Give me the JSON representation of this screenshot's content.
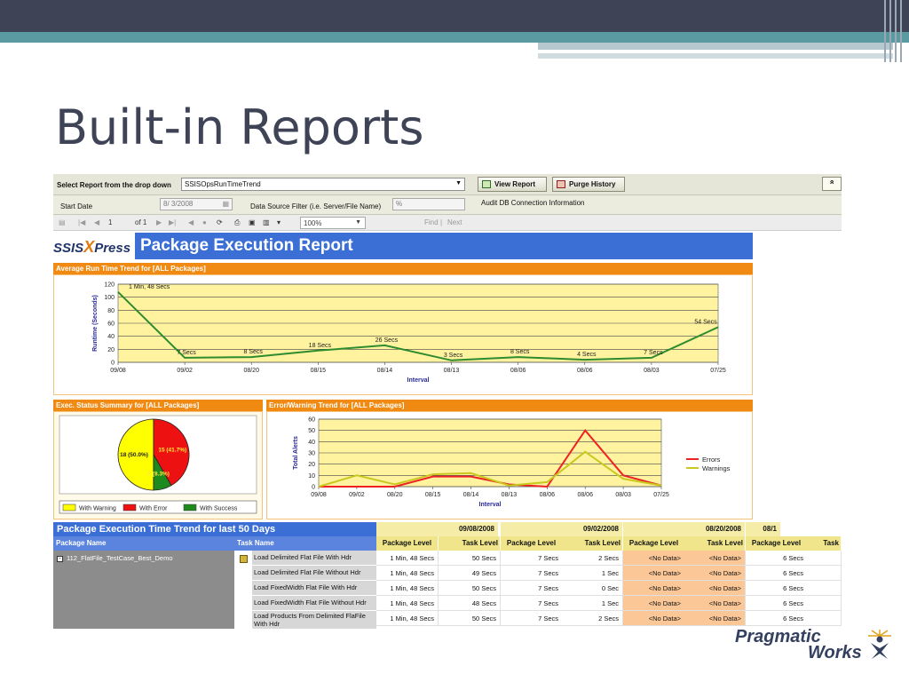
{
  "slide": {
    "title": "Built-in Reports"
  },
  "report_viewer": {
    "select_label": "Select Report from the drop down",
    "selected_report": "SSISOpsRunTimeTrend",
    "view_report_label": "View Report",
    "purge_history_label": "Purge History",
    "collapse_glyph": "»",
    "start_date_label": "Start Date",
    "start_date_value": "8/ 3/2008",
    "data_source_filter_label": "Data Source Filter (i.e. Server/File Name)",
    "data_source_filter_value": "%",
    "audit_db_label": "Audit DB Connection Information"
  },
  "toolbar": {
    "page_current": "1",
    "page_of": "of 1",
    "zoom": "100%",
    "find_label": "Find",
    "next_label": "Next"
  },
  "report_header": {
    "logo_text_1": "SSIS",
    "logo_x": "X",
    "logo_text_2": "Press",
    "title": "Package Execution Report"
  },
  "sections": {
    "avg_runtime": "Average Run Time Trend for [ALL Packages]",
    "exec_status": "Exec. Status Summary for [ALL Packages]",
    "error_warning": "Error/Warning Trend for [ALL Packages]"
  },
  "chart_data": [
    {
      "type": "line",
      "title": "Average Run Time Trend for [ALL Packages]",
      "xlabel": "Interval",
      "ylabel": "Runtime (Seconds)",
      "ylim": [
        0,
        120
      ],
      "yticks": [
        0,
        20,
        40,
        60,
        80,
        100,
        120
      ],
      "categories": [
        "09/08",
        "09/02",
        "08/20",
        "08/15",
        "08/14",
        "08/13",
        "08/06",
        "08/06",
        "08/03",
        "07/25"
      ],
      "series": [
        {
          "values": [
            108,
            7,
            8,
            18,
            26,
            3,
            8,
            4,
            7,
            54
          ],
          "labels": [
            "1 Min, 48 Secs",
            "7 Secs",
            "8 Secs",
            "18 Secs",
            "26 Secs",
            "3 Secs",
            "8 Secs",
            "4 Secs",
            "7 Secs",
            "54 Secs"
          ],
          "color": "#2e8b2e"
        }
      ],
      "grid": true,
      "plot_background": "#fff3a0"
    },
    {
      "type": "pie",
      "title": "Exec. Status Summary for [ALL Packages]",
      "slices": [
        {
          "name": "With Warning",
          "value": 50.0,
          "label": "18 (50.0%)",
          "color": "#ffff00"
        },
        {
          "name": "With Error",
          "value": 41.7,
          "label": "15 (41.7%)",
          "color": "#ee1111"
        },
        {
          "name": "With Success",
          "value": 8.3,
          "label": "3 (8.3%)",
          "color": "#1e8a1e"
        }
      ],
      "legend_position": "bottom"
    },
    {
      "type": "line",
      "title": "Error/Warning Trend for [ALL Packages]",
      "xlabel": "Interval",
      "ylabel": "Total Alerts",
      "ylim": [
        0,
        60
      ],
      "yticks": [
        0,
        10,
        20,
        30,
        40,
        50,
        60
      ],
      "categories": [
        "09/08",
        "09/02",
        "08/20",
        "08/15",
        "08/14",
        "08/13",
        "08/06",
        "08/06",
        "08/03",
        "07/25"
      ],
      "series": [
        {
          "name": "Errors",
          "values": [
            0,
            0,
            0,
            9,
            9,
            2,
            0,
            50,
            10,
            1
          ],
          "color": "#ee2222"
        },
        {
          "name": "Warnings",
          "values": [
            0,
            10,
            2,
            11,
            12,
            1,
            4,
            31,
            7,
            1
          ],
          "color": "#c8c81e"
        }
      ],
      "legend_position": "right",
      "grid": true,
      "plot_background": "#fff3a0"
    }
  ],
  "table": {
    "title": "Package Execution Time Trend for last 50 Days",
    "col_package": "Package Name",
    "col_task": "Task Name",
    "dates": [
      "09/08/2008",
      "09/02/2008",
      "08/20/2008",
      "08/1"
    ],
    "level_headers": [
      "Package Level",
      "Task Level",
      "Package Level",
      "Task Level",
      "Package Level",
      "Task Level",
      "Package Level",
      "Task"
    ],
    "package_name": "112_FlatFile_TestCase_Best_Demo",
    "expand_glyph": "-",
    "rows": [
      {
        "task": "Load Delimited Flat File With Hdr",
        "values": [
          "1 Min, 48 Secs",
          "50 Secs",
          "7 Secs",
          "2 Secs",
          "<No Data>",
          "<No Data>",
          "6 Secs",
          ""
        ]
      },
      {
        "task": "Load Delimited Flat File Without Hdr",
        "values": [
          "1 Min, 48 Secs",
          "49 Secs",
          "7 Secs",
          "1 Sec",
          "<No Data>",
          "<No Data>",
          "6 Secs",
          ""
        ]
      },
      {
        "task": "Load FixedWidth Flat File With Hdr",
        "values": [
          "1 Min, 48 Secs",
          "50 Secs",
          "7 Secs",
          "0 Sec",
          "<No Data>",
          "<No Data>",
          "6 Secs",
          ""
        ]
      },
      {
        "task": "Load FixedWidth Flat File Without Hdr",
        "values": [
          "1 Min, 48 Secs",
          "48 Secs",
          "7 Secs",
          "1 Sec",
          "<No Data>",
          "<No Data>",
          "6 Secs",
          ""
        ]
      },
      {
        "task": "Load Products From Delimited FlaFile With Hdr",
        "values": [
          "1 Min, 48 Secs",
          "50 Secs",
          "7 Secs",
          "2 Secs",
          "<No Data>",
          "<No Data>",
          "6 Secs",
          ""
        ]
      }
    ]
  },
  "brand": {
    "line1": "Pragmatic",
    "line2": "Works"
  },
  "colors": {
    "accent_blue": "#3b6fd6",
    "section_orange": "#f08a12",
    "no_data_fill": "#fbc796"
  }
}
